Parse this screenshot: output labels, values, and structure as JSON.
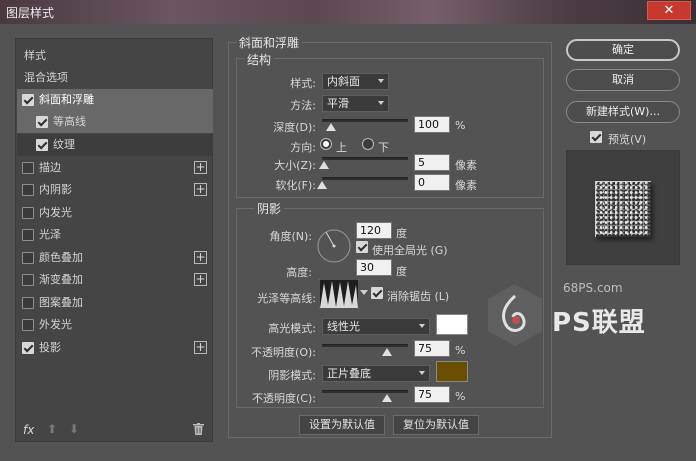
{
  "window": {
    "title": "图层样式",
    "close_glyph": "✕"
  },
  "style_list": {
    "items": [
      {
        "label": "样式",
        "checkbox": false,
        "checked": false,
        "plus": false
      },
      {
        "label": "混合选项",
        "checkbox": false,
        "checked": false,
        "plus": false
      },
      {
        "label": "斜面和浮雕",
        "checkbox": true,
        "checked": true,
        "plus": false,
        "selected": true
      },
      {
        "label": "等高线",
        "checkbox": true,
        "checked": true,
        "plus": false,
        "sub": true
      },
      {
        "label": "纹理",
        "checkbox": true,
        "checked": true,
        "plus": false,
        "sub": true
      },
      {
        "label": "描边",
        "checkbox": true,
        "checked": false,
        "plus": true
      },
      {
        "label": "内阴影",
        "checkbox": true,
        "checked": false,
        "plus": true
      },
      {
        "label": "内发光",
        "checkbox": true,
        "checked": false,
        "plus": false
      },
      {
        "label": "光泽",
        "checkbox": true,
        "checked": false,
        "plus": false
      },
      {
        "label": "颜色叠加",
        "checkbox": true,
        "checked": false,
        "plus": true
      },
      {
        "label": "渐变叠加",
        "checkbox": true,
        "checked": false,
        "plus": true
      },
      {
        "label": "图案叠加",
        "checkbox": true,
        "checked": false,
        "plus": false
      },
      {
        "label": "外发光",
        "checkbox": true,
        "checked": false,
        "plus": false
      },
      {
        "label": "投影",
        "checkbox": true,
        "checked": true,
        "plus": true
      }
    ],
    "footer": {
      "fx": "fx",
      "up": "⬆",
      "down": "⬇"
    }
  },
  "bevel": {
    "group_title": "斜面和浮雕",
    "structure": {
      "title": "结构",
      "style_label": "样式:",
      "style_value": "内斜面",
      "technique_label": "方法:",
      "technique_value": "平滑",
      "depth_label": "深度(D):",
      "depth_value": "100",
      "depth_unit": "%",
      "depth_level": 0.1,
      "direction_label": "方向:",
      "direction_up": "上",
      "direction_down": "下",
      "size_label": "大小(Z):",
      "size_value": "5",
      "size_unit": "像素",
      "size_level": 0.02,
      "soften_label": "软化(F):",
      "soften_value": "0",
      "soften_unit": "像素",
      "soften_level": 0
    },
    "shading": {
      "title": "阴影",
      "angle_label": "角度(N):",
      "angle_value": "120",
      "angle_unit": "度",
      "global_light_label": "使用全局光 (G)",
      "altitude_label": "高度:",
      "altitude_value": "30",
      "altitude_unit": "度",
      "gloss_label": "光泽等高线:",
      "antialias_label": "消除锯齿 (L)",
      "highlight_mode_label": "高光模式:",
      "highlight_mode_value": "线性光",
      "highlight_color": "#ffffff",
      "highlight_opacity_label": "不透明度(O):",
      "highlight_opacity_value": "75",
      "highlight_opacity_unit": "%",
      "highlight_opacity_level": 0.75,
      "shadow_mode_label": "阴影模式:",
      "shadow_mode_value": "正片叠底",
      "shadow_color": "#6b4f00",
      "shadow_opacity_label": "不透明度(C):",
      "shadow_opacity_value": "75",
      "shadow_opacity_unit": "%",
      "shadow_opacity_level": 0.75
    },
    "make_default": "设置为默认值",
    "reset_default": "复位为默认值"
  },
  "actions": {
    "ok": "确定",
    "cancel": "取消",
    "new_style": "新建样式(W)...",
    "preview_label": "预览(V)"
  },
  "watermark": {
    "site": "68PS.com",
    "brand": "PS联盟"
  }
}
